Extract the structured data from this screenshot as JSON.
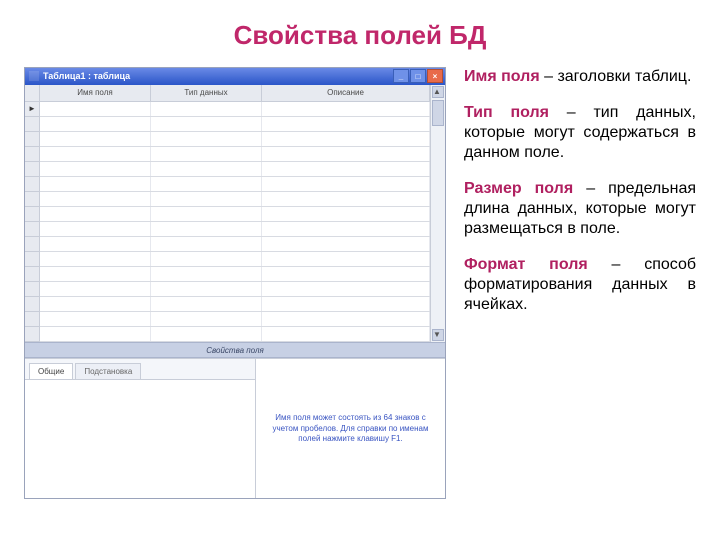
{
  "title": "Свойства полей БД",
  "window": {
    "caption": "Таблица1 : таблица",
    "headers": {
      "c1": "Имя поля",
      "c2": "Тип данных",
      "c3": "Описание"
    },
    "row_marker": "►",
    "section_label": "Свойства поля",
    "tabs": {
      "general": "Общие",
      "lookup": "Подстановка"
    },
    "hint": "Имя поля может состоять из 64 знаков с учетом пробелов. Для справки по именам полей нажмите клавишу F1.",
    "btn_min": "_",
    "btn_max": "□",
    "btn_close": "×",
    "sb_up": "▲",
    "sb_down": "▼"
  },
  "defs": {
    "d1_term": "Имя поля",
    "d1_rest": " – заголовки таблиц.",
    "d2_term": "Тип поля",
    "d2_rest": " – тип данных, которые могут содержаться в данном поле.",
    "d3_term": "Размер поля",
    "d3_rest": " – предельная длина данных, которые могут размещаться в поле.",
    "d4_term": "Формат поля",
    "d4_rest": " – способ форматирования данных в ячейках."
  }
}
